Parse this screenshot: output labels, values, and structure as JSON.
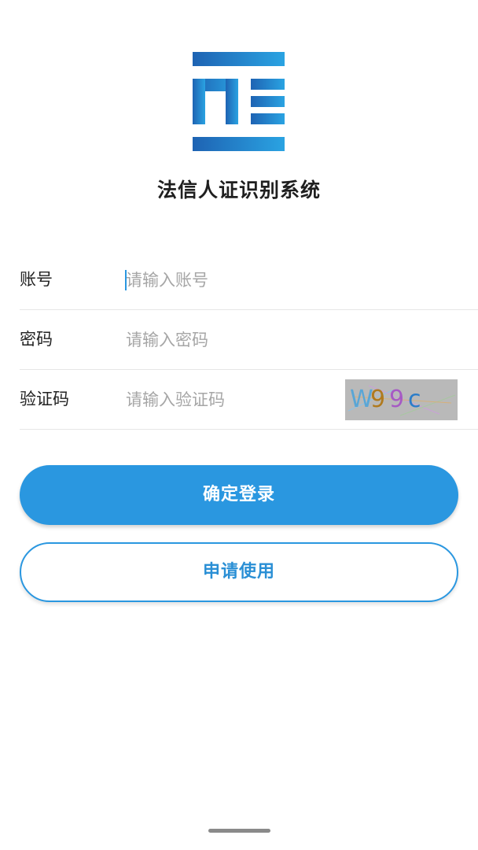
{
  "app": {
    "title": "法信人证识别系统",
    "accent_color": "#2a97e0",
    "logo_icon": "app-logo-icon"
  },
  "form": {
    "account": {
      "label": "账号",
      "placeholder": "请输入账号",
      "value": ""
    },
    "password": {
      "label": "密码",
      "placeholder": "请输入密码",
      "value": ""
    },
    "captcha": {
      "label": "验证码",
      "placeholder": "请输入验证码",
      "value": "",
      "image_text": [
        "W",
        "9",
        "9",
        "c"
      ],
      "image_colors": [
        "#59a6d6",
        "#b07a1e",
        "#a65ac4",
        "#2b7dc9"
      ]
    }
  },
  "buttons": {
    "login_label": "确定登录",
    "apply_label": "申请使用"
  }
}
